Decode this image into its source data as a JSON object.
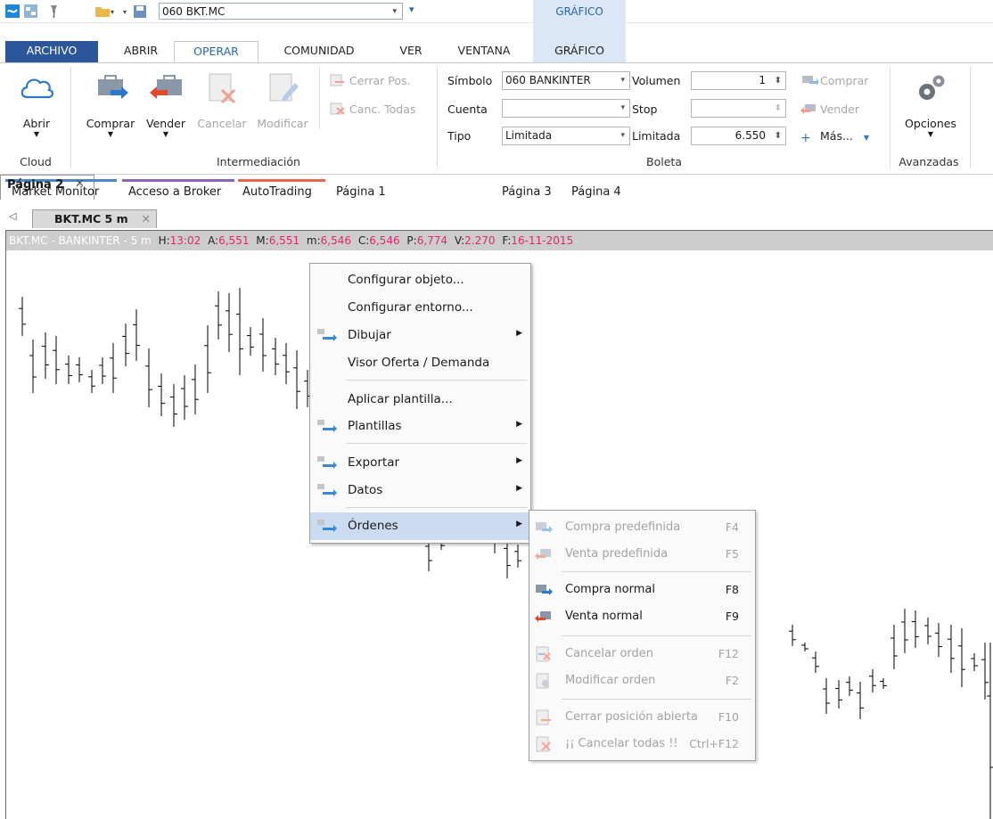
{
  "quickbar": {
    "symbol_value": "060 BKT.MC",
    "context_header": "GRÁFICO"
  },
  "tabs": [
    "ARCHIVO",
    "ABRIR",
    "OPERAR",
    "COMUNIDAD",
    "VER",
    "VENTANA",
    "GRÁFICO"
  ],
  "ribbon": {
    "cloud": {
      "open_label": "Abrir",
      "group_label": "Cloud"
    },
    "trading": {
      "buy_label": "Comprar",
      "sell_label": "Vender",
      "cancel_label": "Cancelar",
      "modify_label": "Modificar",
      "close_pos_label": "Cerrar Pos.",
      "cancel_all_label": "Canc. Todas",
      "group_label": "Intermediación"
    },
    "ticket": {
      "symbol_label": "Símbolo",
      "symbol_value": "060 BANKINTER",
      "account_label": "Cuenta",
      "account_value": "",
      "type_label": "Tipo",
      "type_value": "Limitada",
      "volume_label": "Volumen",
      "volume_value": "1",
      "stop_label": "Stop",
      "stop_value": "",
      "limit_label": "Limitada",
      "limit_value": "6.550",
      "buy_label": "Comprar",
      "sell_label": "Vender",
      "more_label": "Más...",
      "group_label": "Boleta"
    },
    "advanced": {
      "options_label": "Opciones",
      "group_label": "Avanzadas"
    }
  },
  "page_tabs": {
    "market_monitor": "Market Monitor",
    "broker": "Acceso a Broker",
    "autotrading": "AutoTrading",
    "p1": "Página 1",
    "p2": "Página 2",
    "p3": "Página 3",
    "p4": "Página 4",
    "colors": {
      "market_monitor": "#4a86c8",
      "broker": "#8e62b6",
      "autotrading": "#e26a4a"
    }
  },
  "doc_tab": {
    "label": "BKT.MC 5 m"
  },
  "chart": {
    "name": "BKT.MC - BANKINTER - 5 m",
    "h_label": "H:",
    "h_value": "13:02",
    "a_label": "A:",
    "a_value": "6,551",
    "m_label": "M:",
    "m_value": "6,551",
    "ml_label": "m:",
    "ml_value": "6,546",
    "c_label": "C:",
    "c_value": "6,546",
    "p_label": "P:",
    "p_value": "6,774",
    "v_label": "V:",
    "v_value": "2.270",
    "f_label": "F:",
    "f_value": "16-11-2015"
  },
  "context_menu": {
    "configure_object": "Configurar objeto...",
    "configure_env": "Configurar entorno...",
    "draw": "Dibujar",
    "book": "Visor Oferta / Demanda",
    "apply_template": "Aplicar plantilla...",
    "templates": "Plantillas",
    "export": "Exportar",
    "data": "Datos",
    "orders": "Órdenes"
  },
  "orders_menu": {
    "predef_buy": "Compra predefinida",
    "predef_buy_key": "F4",
    "predef_sell": "Venta predefinida",
    "predef_sell_key": "F5",
    "normal_buy": "Compra normal",
    "normal_buy_key": "F8",
    "normal_sell": "Venta normal",
    "normal_sell_key": "F9",
    "cancel_order": "Cancelar orden",
    "cancel_order_key": "F12",
    "modify_order": "Modificar orden",
    "modify_order_key": "F2",
    "close_pos": "Cerrar posición abierta",
    "close_pos_key": "F10",
    "cancel_all": "¡¡ Cancelar todas !!",
    "cancel_all_key": "Ctrl+F12"
  }
}
